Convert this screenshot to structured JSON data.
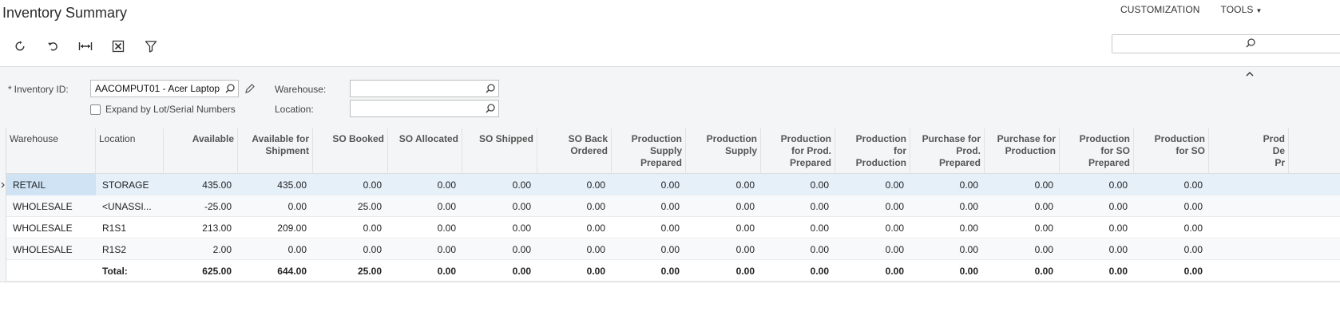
{
  "page": {
    "title": "Inventory Summary"
  },
  "top_links": {
    "customization": "CUSTOMIZATION",
    "tools": "TOOLS"
  },
  "toolbar": {
    "buttons": [
      {
        "icon": "refresh-icon"
      },
      {
        "icon": "undo-icon"
      },
      {
        "icon": "fit-columns-icon"
      },
      {
        "icon": "excel-export-icon"
      },
      {
        "icon": "filter-icon"
      }
    ],
    "search_value": ""
  },
  "form": {
    "inventory_id_label": "Inventory ID:",
    "inventory_id_value": "AACOMPUT01 - Acer Laptop",
    "expand_label": "Expand by Lot/Serial Numbers",
    "expand_checked": false,
    "warehouse_label": "Warehouse:",
    "warehouse_value": "",
    "location_label": "Location:",
    "location_value": ""
  },
  "grid": {
    "columns": [
      [
        "Warehouse"
      ],
      [
        "Location"
      ],
      [
        "Available"
      ],
      [
        "Available for",
        "Shipment"
      ],
      [
        "SO Booked"
      ],
      [
        "SO Allocated"
      ],
      [
        "SO Shipped"
      ],
      [
        "SO Back",
        "Ordered"
      ],
      [
        "Production",
        "Supply",
        "Prepared"
      ],
      [
        "Production",
        "Supply"
      ],
      [
        "Production",
        "for Prod.",
        "Prepared"
      ],
      [
        "Production",
        "for",
        "Production"
      ],
      [
        "Purchase for",
        "Prod.",
        "Prepared"
      ],
      [
        "Purchase for",
        "Production"
      ],
      [
        "Production",
        "for SO",
        "Prepared"
      ],
      [
        "Production",
        "for SO"
      ],
      [
        "Prod",
        "De",
        "Pr"
      ]
    ],
    "rows": [
      [
        "RETAIL",
        "STORAGE",
        "435.00",
        "435.00",
        "0.00",
        "0.00",
        "0.00",
        "0.00",
        "0.00",
        "0.00",
        "0.00",
        "0.00",
        "0.00",
        "0.00",
        "0.00",
        "0.00"
      ],
      [
        "WHOLESALE",
        "<UNASSI...",
        "-25.00",
        "0.00",
        "25.00",
        "0.00",
        "0.00",
        "0.00",
        "0.00",
        "0.00",
        "0.00",
        "0.00",
        "0.00",
        "0.00",
        "0.00",
        "0.00"
      ],
      [
        "WHOLESALE",
        "R1S1",
        "213.00",
        "209.00",
        "0.00",
        "0.00",
        "0.00",
        "0.00",
        "0.00",
        "0.00",
        "0.00",
        "0.00",
        "0.00",
        "0.00",
        "0.00",
        "0.00"
      ],
      [
        "WHOLESALE",
        "R1S2",
        "2.00",
        "0.00",
        "0.00",
        "0.00",
        "0.00",
        "0.00",
        "0.00",
        "0.00",
        "0.00",
        "0.00",
        "0.00",
        "0.00",
        "0.00",
        "0.00"
      ]
    ],
    "total": [
      "",
      "Total:",
      "625.00",
      "644.00",
      "25.00",
      "0.00",
      "0.00",
      "0.00",
      "0.00",
      "0.00",
      "0.00",
      "0.00",
      "0.00",
      "0.00",
      "0.00",
      "0.00"
    ],
    "selected_row": 0
  }
}
